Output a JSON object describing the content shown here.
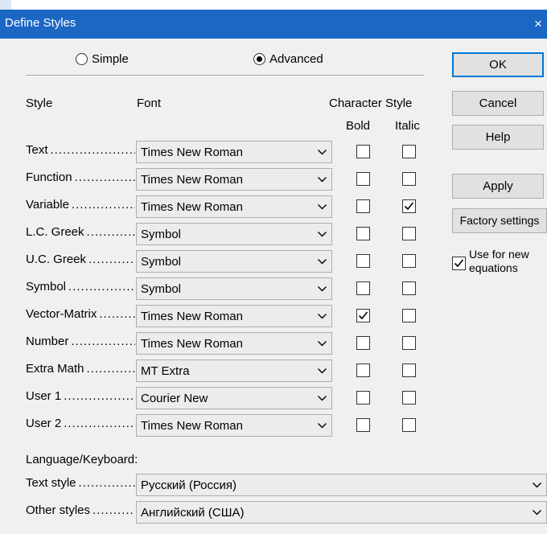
{
  "window": {
    "title": "Define Styles",
    "close_glyph": "×"
  },
  "mode": {
    "simple_label": "Simple",
    "advanced_label": "Advanced",
    "selected": "Advanced"
  },
  "headers": {
    "style": "Style",
    "font": "Font",
    "character_style": "Character Style",
    "bold": "Bold",
    "italic": "Italic"
  },
  "rows": [
    {
      "label": "Text",
      "font": "Times New Roman",
      "bold": false,
      "italic": false
    },
    {
      "label": "Function",
      "font": "Times New Roman",
      "bold": false,
      "italic": false
    },
    {
      "label": "Variable",
      "font": "Times New Roman",
      "bold": false,
      "italic": true
    },
    {
      "label": "L.C. Greek",
      "font": "Symbol",
      "bold": false,
      "italic": false
    },
    {
      "label": "U.C. Greek",
      "font": "Symbol",
      "bold": false,
      "italic": false
    },
    {
      "label": "Symbol",
      "font": "Symbol",
      "bold": false,
      "italic": false
    },
    {
      "label": "Vector-Matrix",
      "font": "Times New Roman",
      "bold": true,
      "italic": false
    },
    {
      "label": "Number",
      "font": "Times New Roman",
      "bold": false,
      "italic": false
    },
    {
      "label": "Extra Math",
      "font": "MT Extra",
      "bold": false,
      "italic": false
    },
    {
      "label": "User 1",
      "font": "Courier New",
      "bold": false,
      "italic": false
    },
    {
      "label": "User 2",
      "font": "Times New Roman",
      "bold": false,
      "italic": false
    }
  ],
  "buttons": {
    "ok": "OK",
    "cancel": "Cancel",
    "help": "Help",
    "apply": "Apply",
    "factory": "Factory settings"
  },
  "use_for_new": {
    "label_line1": "Use for new",
    "label_line2": "equations",
    "checked": true
  },
  "language": {
    "heading": "Language/Keyboard:",
    "text_style_label": "Text style",
    "text_style_value": "Русский (Россия)",
    "other_styles_label": "Other styles",
    "other_styles_value": "Английский (США)"
  },
  "colors": {
    "titlebar": "#1c66c4",
    "accent": "#0078d7",
    "dialog_bg": "#f0f0f0"
  }
}
